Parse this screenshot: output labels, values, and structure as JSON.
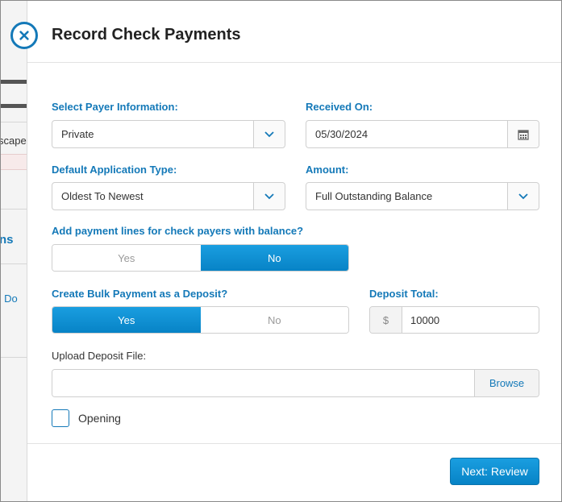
{
  "background": {
    "text_1": "scape",
    "text_2": "ns",
    "text_3": "• Do"
  },
  "modal": {
    "title": "Record Check Payments",
    "close_icon": "close-circle-icon"
  },
  "payer": {
    "label": "Select Payer Information:",
    "value": "Private"
  },
  "received_on": {
    "label": "Received On:",
    "value": "05/30/2024",
    "icon": "calendar-icon"
  },
  "application_type": {
    "label": "Default Application Type:",
    "value": "Oldest To Newest"
  },
  "amount": {
    "label": "Amount:",
    "value": "Full Outstanding Balance"
  },
  "payment_lines": {
    "label": "Add payment lines for check payers with balance?",
    "options": [
      "Yes",
      "No"
    ],
    "selected": "No"
  },
  "bulk_deposit": {
    "label": "Create Bulk Payment as a Deposit?",
    "options": [
      "Yes",
      "No"
    ],
    "selected": "Yes"
  },
  "deposit_total": {
    "label": "Deposit Total:",
    "prefix": "$",
    "value": "10000"
  },
  "upload": {
    "label": "Upload Deposit File:",
    "browse_label": "Browse"
  },
  "opening": {
    "label": "Opening",
    "checked": false
  },
  "footer": {
    "next_label": "Next: Review"
  },
  "colors": {
    "accent": "#1479b8",
    "primary_button": "#0b8ed4"
  }
}
